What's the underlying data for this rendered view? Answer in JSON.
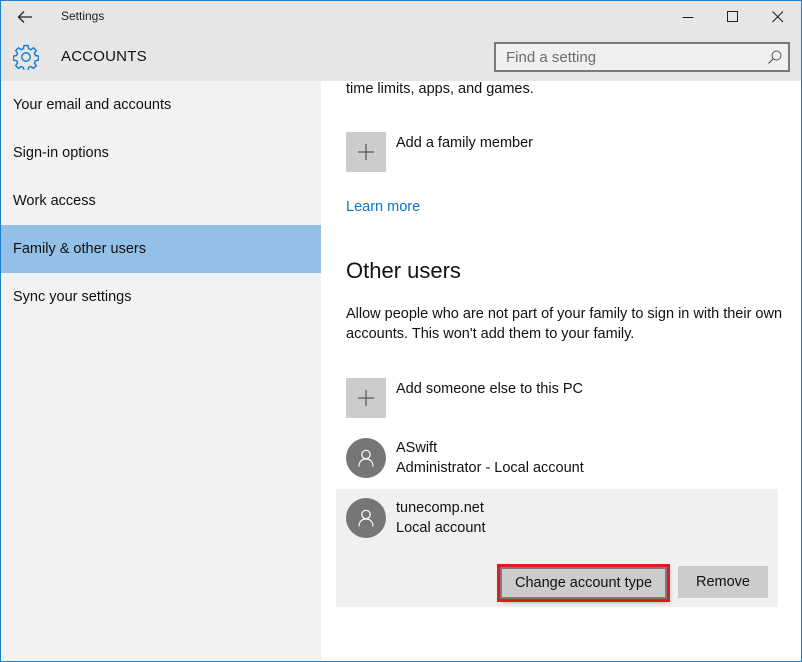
{
  "window": {
    "app_title": "Settings",
    "controls": {
      "minimize": "minimize-icon",
      "maximize": "maximize-icon",
      "close": "close-icon"
    }
  },
  "header": {
    "section_title": "ACCOUNTS",
    "icon": "gear-icon",
    "search": {
      "placeholder": "Find a setting",
      "value": ""
    }
  },
  "sidebar": {
    "items": [
      {
        "label": "Your email and accounts",
        "selected": false
      },
      {
        "label": "Sign-in options",
        "selected": false
      },
      {
        "label": "Work access",
        "selected": false
      },
      {
        "label": "Family & other users",
        "selected": true
      },
      {
        "label": "Sync your settings",
        "selected": false
      }
    ]
  },
  "main": {
    "family": {
      "intro_tail": "time limits, apps, and games.",
      "add_label": "Add a family member",
      "learn_more": "Learn more"
    },
    "other_users": {
      "heading": "Other users",
      "description": "Allow people who are not part of your family to sign in with their own accounts. This won't add them to your family.",
      "add_label": "Add someone else to this PC",
      "users": [
        {
          "name": "ASwift",
          "type": "Administrator - Local account"
        },
        {
          "name": "tunecomp.net",
          "type": "Local account",
          "selected": true
        }
      ],
      "actions": {
        "change_type": "Change account type",
        "remove": "Remove"
      }
    }
  },
  "colors": {
    "accent": "#1e7fd0",
    "selection": "#92c0e6",
    "link": "#0f73c6",
    "highlight_box": "#e11a1a"
  }
}
